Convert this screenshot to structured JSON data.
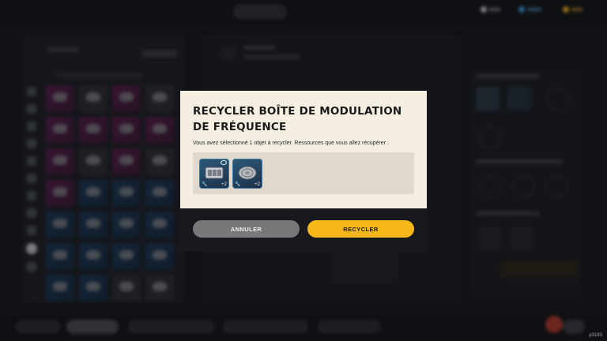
{
  "dialog": {
    "title": "Recycler boîte de modulation de fréquence",
    "message": "Vous avez sélectionné 1 objet à recycler. Ressources que vous allez récupérer :",
    "resources": [
      {
        "icon": "battery-pack-icon",
        "quantity": "+2"
      },
      {
        "icon": "wire-coil-icon",
        "quantity": "+2"
      }
    ],
    "cancel_label": "ANNULER",
    "recycle_label": "RECYCLER"
  },
  "build": "p3183",
  "colors": {
    "dialog_bg": "#f5eee3",
    "accent": "#f6b818",
    "cancel": "#78777a",
    "rare_blue": "#1c3047",
    "epic_magenta": "#5a1d4c"
  }
}
